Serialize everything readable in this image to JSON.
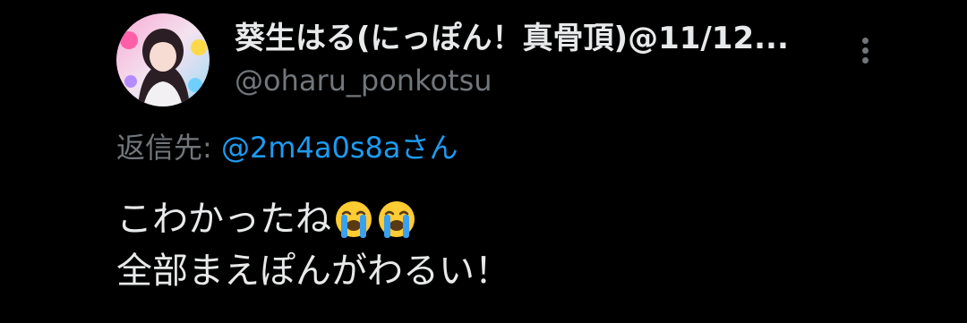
{
  "author": {
    "display_name": "葵生はる(にっぽん！真骨頂)@11/12...",
    "handle": "@oharu_ponkotsu",
    "avatar_icon": "user-avatar-photo"
  },
  "menu": {
    "icon": "more-vertical-icon"
  },
  "reply": {
    "prefix": "返信先: ",
    "target": "@2m4a0s8aさん"
  },
  "tweet": {
    "line1_text": "こわかったね",
    "line1_emoji": [
      "loudly-crying-face",
      "loudly-crying-face"
    ],
    "line2_text": "全部まえぽんがわるい！"
  },
  "colors": {
    "background": "#000000",
    "primary_text": "#e7e9ea",
    "secondary_text": "#71767b",
    "link": "#1d9bf0"
  }
}
